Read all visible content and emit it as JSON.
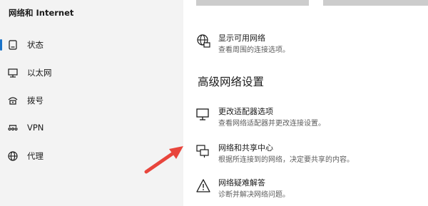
{
  "sidebar": {
    "title": "网络和 Internet",
    "items": [
      {
        "label": "状态",
        "icon": "status-icon",
        "active": true
      },
      {
        "label": "以太网",
        "icon": "ethernet-icon"
      },
      {
        "label": "拨号",
        "icon": "dialup-icon"
      },
      {
        "label": "VPN",
        "icon": "vpn-icon"
      },
      {
        "label": "代理",
        "icon": "proxy-icon"
      }
    ]
  },
  "main": {
    "show_networks": {
      "title": "显示可用网络",
      "desc": "查看周围的连接选项。",
      "icon": "globe-network-icon"
    },
    "advanced_heading": "高级网络设置",
    "settings": [
      {
        "title": "更改适配器选项",
        "desc": "查看网络适配器并更改连接设置。",
        "icon": "adapter-monitor-icon"
      },
      {
        "title": "网络和共享中心",
        "desc": "根据所连接到的网络，决定要共享的内容。",
        "icon": "sharing-center-icon"
      },
      {
        "title": "网络疑难解答",
        "desc": "诊断并解决网络问题。",
        "icon": "warning-icon"
      }
    ]
  },
  "colors": {
    "accent": "#1a73c9",
    "arrow": "#e8453c",
    "sidebar_bg": "#f3f3f3"
  }
}
